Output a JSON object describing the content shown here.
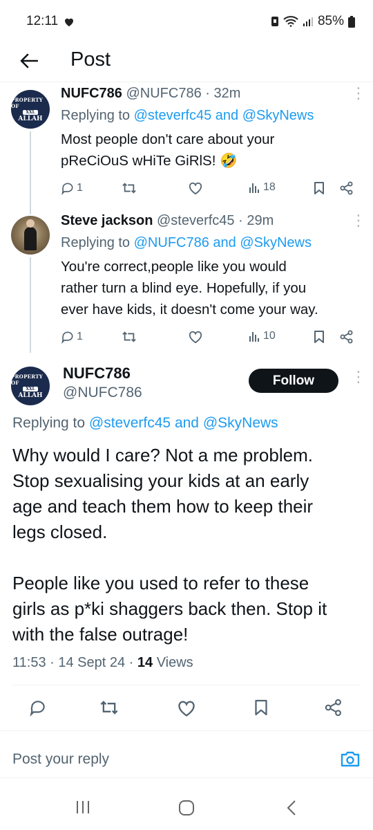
{
  "status_bar": {
    "time": "12:11",
    "battery": "85%"
  },
  "header": {
    "title": "Post"
  },
  "tweets": [
    {
      "name": "NUFC786",
      "handle": "@NUFC786",
      "time": "· 32m",
      "avatar_text": [
        "PROPERTY OF",
        "XXL",
        "ALLAH"
      ],
      "replying_prefix": "Replying to ",
      "reply_a": "@steverfc45",
      "reply_and": " and ",
      "reply_b": "@SkyNews",
      "text_lines": [
        "Most people don't care about your",
        "pReCiOuS wHiTe GiRlS! 🤣"
      ],
      "replies": "1",
      "views": "18"
    },
    {
      "name": "Steve jackson",
      "handle": "@steverfc45",
      "time": "· 29m",
      "replying_prefix": "Replying to ",
      "reply_a": "@NUFC786",
      "reply_and": " and ",
      "reply_b": "@SkyNews",
      "text_lines": [
        "You're correct,people like you would",
        "rather turn a blind eye. Hopefully, if you",
        "ever have kids, it doesn't come your way."
      ],
      "replies": "1",
      "views": "10"
    }
  ],
  "main_post": {
    "name": "NUFC786",
    "handle": "@NUFC786",
    "avatar_text": [
      "PROPERTY OF",
      "XXL",
      "ALLAH"
    ],
    "follow_label": "Follow",
    "replying_prefix": "Replying to ",
    "reply_a": "@steverfc45",
    "reply_and": " and ",
    "reply_b": "@SkyNews",
    "text_lines": [
      "Why would I care? Not a me problem.",
      "Stop sexualising your kids at an early",
      "age and teach them how to keep their",
      "legs closed.",
      "",
      "People like you used to refer to these",
      "girls as p*ki shaggers back then. Stop it",
      "with the false outrage!"
    ],
    "time": "11:53",
    "date": "· 14 Sept 24 ·",
    "views_count": "14",
    "views_label": " Views"
  },
  "reply_bar": {
    "placeholder": "Post your reply"
  },
  "colors": {
    "accent": "#1d9bf0",
    "text": "#0f1419",
    "secondary": "#536471"
  }
}
